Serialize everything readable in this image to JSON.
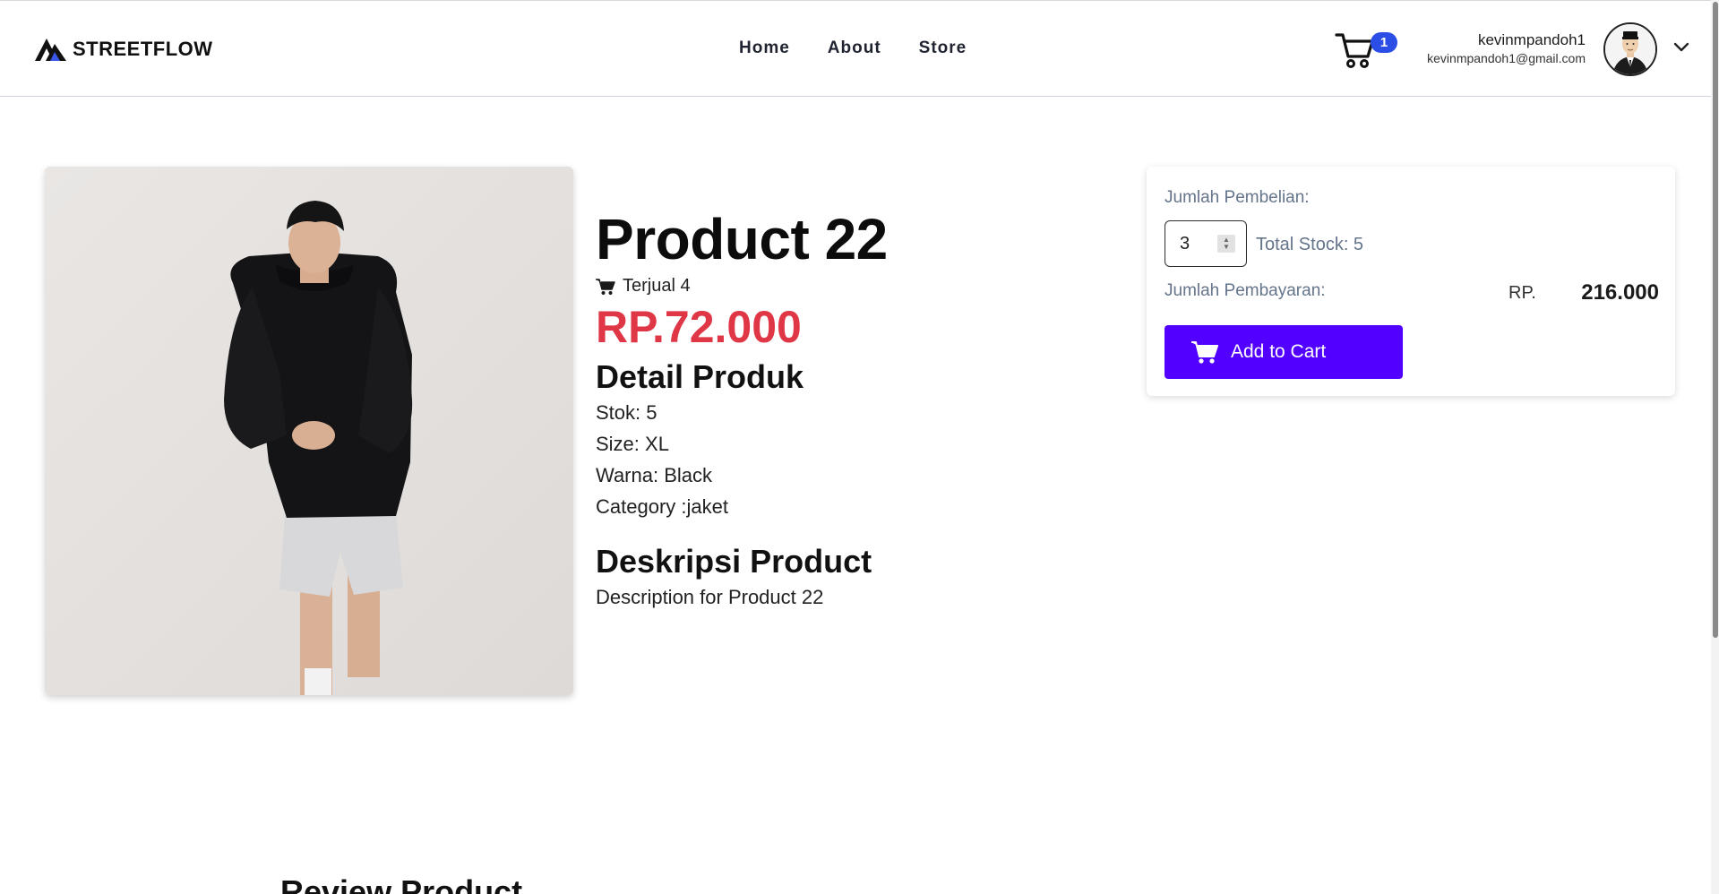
{
  "brand": {
    "name": "STREETFLOW",
    "icon": "mountain-logo-icon"
  },
  "nav": {
    "items": [
      {
        "label": "Home"
      },
      {
        "label": "About"
      },
      {
        "label": "Store"
      }
    ]
  },
  "cart": {
    "count": "1",
    "icon": "shopping-cart-icon"
  },
  "user": {
    "name": "kevinmpandoh1",
    "email": "kevinmpandoh1@gmail.com",
    "avatar_icon": "user-avatar-icon",
    "dropdown_icon": "chevron-down-icon"
  },
  "product": {
    "title": "Product 22",
    "sold": "Terjual 4",
    "price": "RP.72.000",
    "detail_heading": "Detail Produk",
    "details": [
      "Stok: 5",
      "Size: XL",
      "Warna: Black",
      "Category :jaket"
    ],
    "description_heading": "Deskripsi Product",
    "description": "Description for Product 22"
  },
  "purchase": {
    "quantity_label": "Jumlah Pembelian:",
    "quantity_value": "3",
    "total_stock": "Total Stock: 5",
    "payment_label": "Jumlah Pembayaran:",
    "currency": "RP.",
    "payment_amount": "216.000",
    "add_to_cart": "Add to Cart",
    "button_color": "#5200ff"
  },
  "review": {
    "heading": "Review Product"
  },
  "colors": {
    "price": "#e03747",
    "badge": "#2b4ee6",
    "muted": "#64748b"
  }
}
